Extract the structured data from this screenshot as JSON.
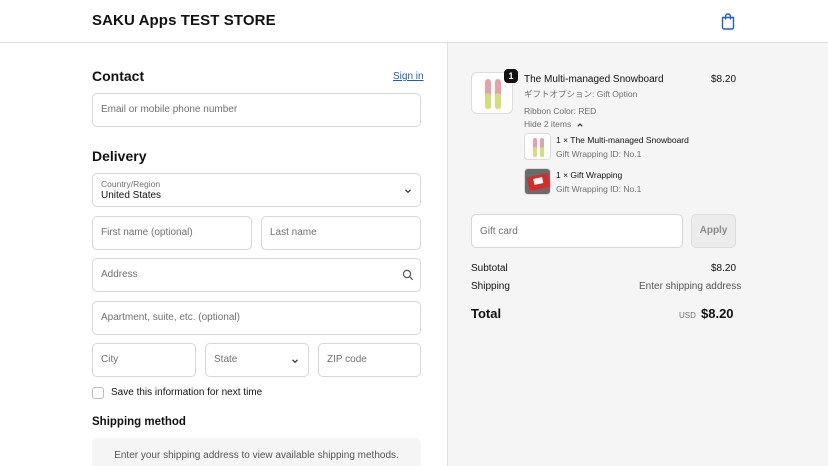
{
  "header": {
    "store_name": "SAKU Apps TEST STORE"
  },
  "contact": {
    "title": "Contact",
    "sign_in": "Sign in",
    "email_placeholder": "Email or mobile phone number"
  },
  "delivery": {
    "title": "Delivery",
    "country_label": "Country/Region",
    "country_value": "United States",
    "first_name_placeholder": "First name (optional)",
    "last_name_placeholder": "Last name",
    "address_placeholder": "Address",
    "apartment_placeholder": "Apartment, suite, etc. (optional)",
    "city_placeholder": "City",
    "state_placeholder": "State",
    "zip_placeholder": "ZIP code",
    "save_info_label": "Save this information for next time"
  },
  "shipping_method": {
    "title": "Shipping method",
    "message": "Enter your shipping address to view available shipping methods."
  },
  "order": {
    "quantity_badge": "1",
    "product_title": "The Multi-managed Snowboard",
    "product_price": "$8.20",
    "product_option": "ギフトオプション: Gift Option",
    "ribbon_color": "Ribbon Color: RED",
    "hide_items": "Hide 2 items",
    "sub_items": [
      {
        "title": "1 × The Multi-managed Snowboard",
        "detail": "Gift Wrapping ID: No.1"
      },
      {
        "title": "1 × Gift Wrapping",
        "detail": "Gift Wrapping ID: No.1"
      }
    ],
    "gift_card_placeholder": "Gift card",
    "apply_label": "Apply",
    "subtotal_label": "Subtotal",
    "subtotal_value": "$8.20",
    "shipping_label": "Shipping",
    "shipping_value": "Enter shipping address",
    "total_label": "Total",
    "currency": "USD",
    "total_value": "$8.20"
  },
  "colors": {
    "link": "#1f5fbf",
    "summary_bg": "#f5f5f5",
    "border": "#d6d6d6"
  },
  "icons": [
    "shopping-bag-icon",
    "chevron-down-icon",
    "search-icon",
    "chevron-up-icon"
  ]
}
